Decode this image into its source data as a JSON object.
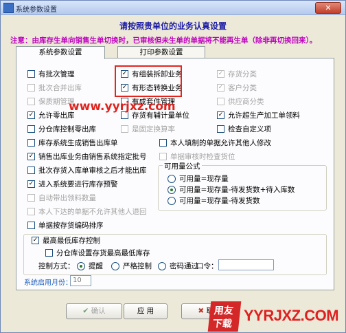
{
  "window": {
    "title": "系统参数设置",
    "close_label": "✕"
  },
  "heading": "请按照贵单位的业务认真设置",
  "notice": "注意：由库存生单向销售生单切换时，已审核但未生单的单据将不能再生单（除非再切换回来）。",
  "tabs": [
    {
      "label": "系统参数设置"
    },
    {
      "label": "打印参数设置"
    }
  ],
  "checkboxes": {
    "c1": [
      {
        "label": "有批次管理",
        "checked": false,
        "disabled": false
      },
      {
        "label": "批次合并出库",
        "checked": false,
        "disabled": true
      },
      {
        "label": "保质期管理",
        "checked": false,
        "disabled": true
      },
      {
        "label": "允许零出库",
        "checked": true,
        "disabled": false
      },
      {
        "label": "分仓库控制零出库",
        "checked": false,
        "disabled": false
      },
      {
        "label": "库存系统生成销售出库单",
        "checked": false,
        "disabled": false
      },
      {
        "label": "销售出库业务由销售系统指定批号",
        "checked": true,
        "disabled": false
      },
      {
        "label": "批次存货入库单审核之后才能出库",
        "checked": false,
        "disabled": false
      },
      {
        "label": "进入系统要进行库存预警",
        "checked": true,
        "disabled": false
      },
      {
        "label": "自动带出领料数量",
        "checked": false,
        "disabled": true
      },
      {
        "label": "本人下达的单据不允许其他人退回",
        "checked": false,
        "disabled": true
      },
      {
        "label": "单据按存货编码排序",
        "checked": false,
        "disabled": false
      }
    ],
    "c2": [
      {
        "label": "有组装拆卸业务",
        "checked": true,
        "disabled": false
      },
      {
        "label": "有形态转换业务",
        "checked": true,
        "disabled": false
      },
      {
        "label": "有成套件管理",
        "checked": false,
        "disabled": false
      },
      {
        "label": "存货有辅计量单位",
        "checked": false,
        "disabled": false
      },
      {
        "label": "是固定换算率",
        "checked": false,
        "disabled": true
      }
    ],
    "c2_lower": [
      {
        "label": "本人填制的单据允许其他人修改",
        "checked": false,
        "disabled": false
      },
      {
        "label": "单据审核时检查货位",
        "checked": false,
        "disabled": true
      }
    ],
    "c3": [
      {
        "label": "存货分类",
        "checked": true,
        "disabled": true
      },
      {
        "label": "客户分类",
        "checked": true,
        "disabled": true
      },
      {
        "label": "供应商分类",
        "checked": false,
        "disabled": true
      },
      {
        "label": "允许超生产加工单领料",
        "checked": true,
        "disabled": false
      },
      {
        "label": "检查自定义项",
        "checked": false,
        "disabled": false
      }
    ]
  },
  "available": {
    "title": "可用量公式",
    "options": [
      {
        "label": "可用量=现存量",
        "selected": false
      },
      {
        "label": "可用量=现存量-待发货数+待入库数",
        "selected": true
      },
      {
        "label": "可用量=现存量-待发货数",
        "selected": false
      }
    ]
  },
  "min_stock": {
    "label": "最高最低库存控制",
    "checked": true,
    "sub_label": "分仓库设置存货最高最低库存",
    "sub_checked": false,
    "mode_label": "控制方式：",
    "modes": [
      {
        "label": "提醒",
        "selected": true
      },
      {
        "label": "严格控制",
        "selected": false
      },
      {
        "label": "密码通过",
        "selected": false
      }
    ],
    "password_label": "口令：",
    "password_value": ""
  },
  "start_month": {
    "label": "系统启用月份：",
    "value": "10"
  },
  "buttons": {
    "ok": "确认",
    "apply": "应 用",
    "cancel": "取消"
  },
  "watermark": "www.yyrjxz.com",
  "logo": {
    "line1": "用友",
    "line2": "下载",
    "text": "YYRJXZ.COM"
  }
}
